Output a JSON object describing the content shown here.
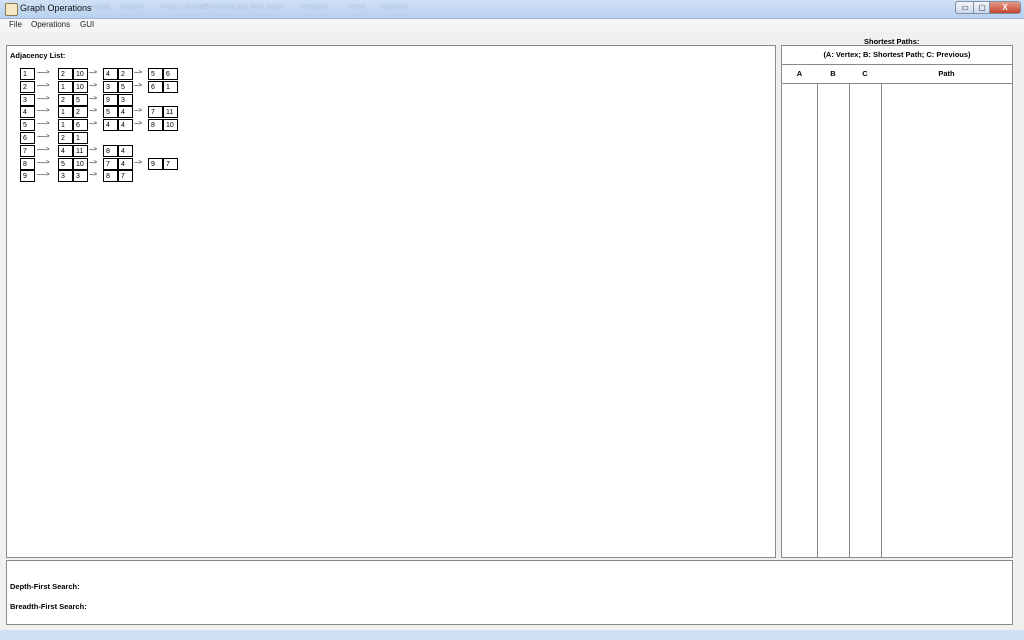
{
  "window": {
    "title": "Graph Operations",
    "ghost_tabs": [
      "HOME",
      "INSERT",
      "PAGE LAYOUT",
      "REFERENCES",
      "MAILINGS",
      "REVIEW",
      "VIEW",
      "EndNote"
    ],
    "min_glyph": "▭",
    "max_glyph": "▢",
    "close_glyph": "X"
  },
  "menu": {
    "items": [
      "File",
      "Operations",
      "GUI"
    ]
  },
  "adjacency": {
    "title": "Adjacency List:",
    "arrow_glyph": "------>",
    "short_arrow_glyph": "--->",
    "rows": [
      {
        "vertex": "1",
        "edges": [
          [
            "2",
            "10"
          ],
          [
            "4",
            "2"
          ],
          [
            "5",
            "6"
          ]
        ]
      },
      {
        "vertex": "2",
        "edges": [
          [
            "1",
            "10"
          ],
          [
            "3",
            "5"
          ],
          [
            "6",
            "1"
          ]
        ]
      },
      {
        "vertex": "3",
        "edges": [
          [
            "2",
            "5"
          ],
          [
            "9",
            "3"
          ]
        ]
      },
      {
        "vertex": "4",
        "edges": [
          [
            "1",
            "2"
          ],
          [
            "5",
            "4"
          ],
          [
            "7",
            "11"
          ]
        ]
      },
      {
        "vertex": "5",
        "edges": [
          [
            "1",
            "6"
          ],
          [
            "4",
            "4"
          ],
          [
            "8",
            "10"
          ]
        ]
      },
      {
        "vertex": "6",
        "edges": [
          [
            "2",
            "1"
          ]
        ]
      },
      {
        "vertex": "7",
        "edges": [
          [
            "4",
            "11"
          ],
          [
            "8",
            "4"
          ]
        ]
      },
      {
        "vertex": "8",
        "edges": [
          [
            "5",
            "10"
          ],
          [
            "7",
            "4"
          ],
          [
            "9",
            "7"
          ]
        ]
      },
      {
        "vertex": "9",
        "edges": [
          [
            "3",
            "3"
          ],
          [
            "8",
            "7"
          ]
        ]
      }
    ]
  },
  "shortest_paths": {
    "title": "Shortest Paths:",
    "legend": "(A: Vertex;  B: Shortest Path;  C: Previous)",
    "columns": [
      "A",
      "B",
      "C",
      "Path"
    ]
  },
  "search": {
    "dfs_label": "Depth-First Search:",
    "bfs_label": "Breadth-First Search:"
  }
}
